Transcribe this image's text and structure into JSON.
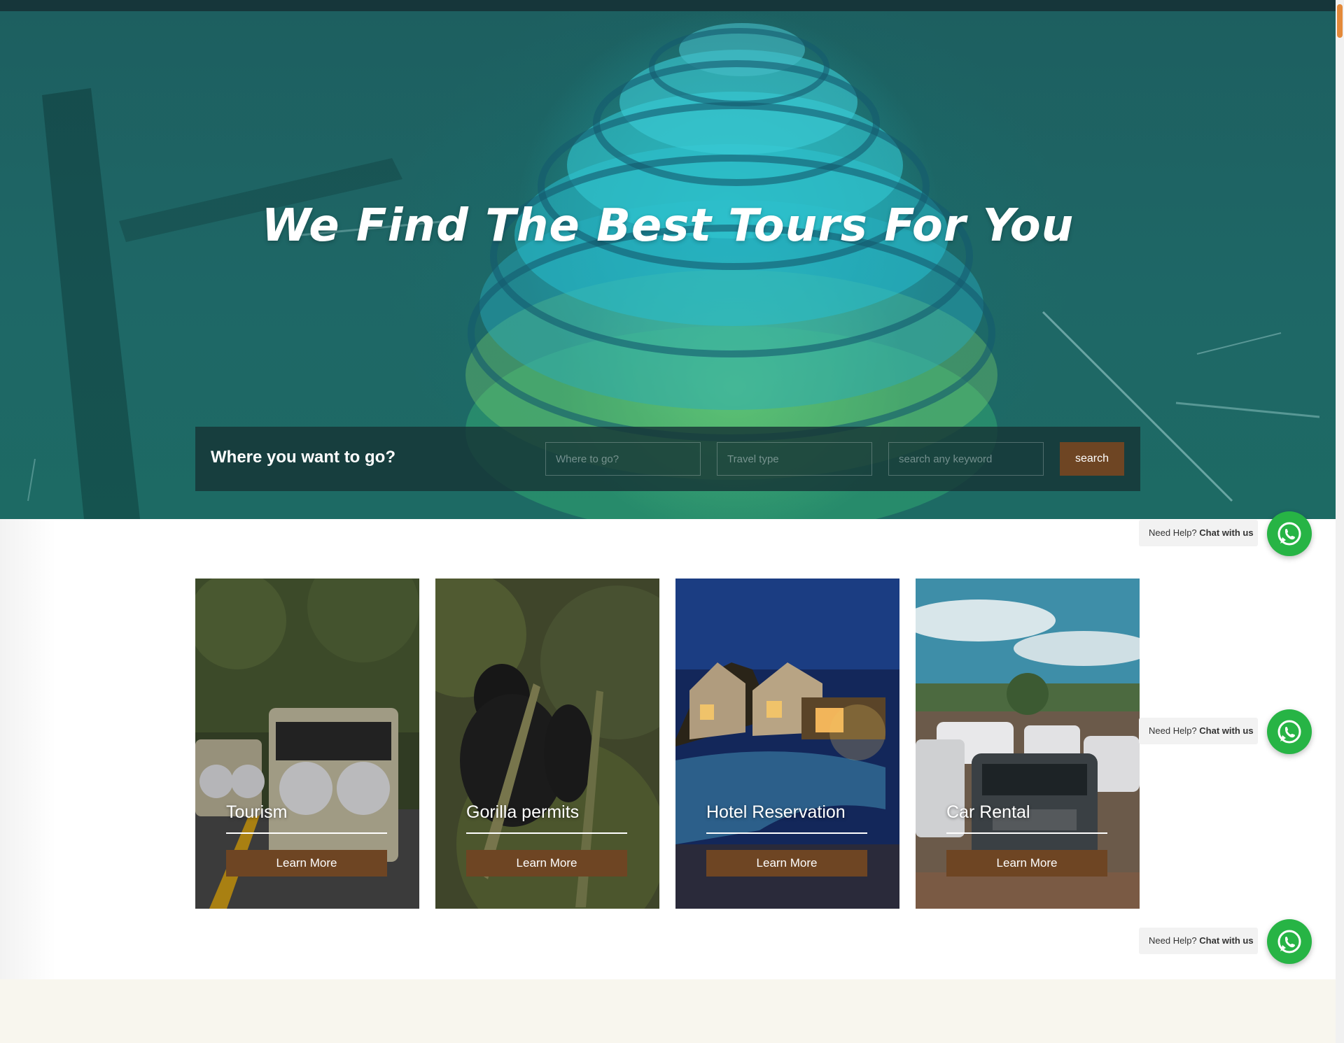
{
  "hero": {
    "title": "We Find The Best Tours For You"
  },
  "search": {
    "label": "Where you want to go?",
    "where_placeholder": "Where to go?",
    "type_placeholder": "Travel type",
    "keyword_placeholder": "search any keyword",
    "button_label": "search"
  },
  "services": [
    {
      "title": "Tourism",
      "button": "Learn More"
    },
    {
      "title": "Gorilla permits",
      "button": "Learn More"
    },
    {
      "title": "Hotel Reservation",
      "button": "Learn More"
    },
    {
      "title": "Car Rental",
      "button": "Learn More"
    }
  ],
  "chat_widget": {
    "prefix": "Need Help?",
    "emphasis": "Chat with us",
    "icon": "whatsapp-icon"
  },
  "colors": {
    "hero_overlay": "#1e6766",
    "accent_brown": "#6e4523",
    "whatsapp_green": "#27b445"
  }
}
